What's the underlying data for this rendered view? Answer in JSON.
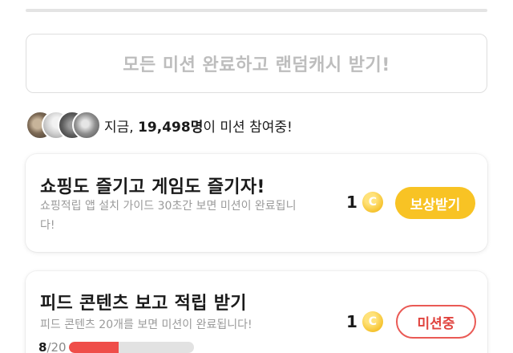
{
  "all_missions_button": "모든 미션 완료하고 랜덤캐시 받기!",
  "participants": {
    "prefix": "지금, ",
    "count": "19,498명",
    "suffix": "이 미션 참여중!"
  },
  "missions": [
    {
      "title": "쇼핑도 즐기고 게임도 즐기자!",
      "description": "쇼핑적립 앱 설치 가이드 30초간 보면 미션이 완료됩니다!",
      "reward": "1",
      "coin_symbol": "C",
      "action": "보상받기",
      "action_color": "#f8c324"
    },
    {
      "title": "피드 콘텐츠 보고 적립 받기",
      "description": "피드 콘텐츠 20개를 보면 미션이 완료됩니다!",
      "reward": "1",
      "coin_symbol": "C",
      "action": "미션중",
      "action_color": "#ea5a55",
      "progress": {
        "current": "8",
        "total": "/20",
        "fraction": 0.4
      }
    }
  ]
}
